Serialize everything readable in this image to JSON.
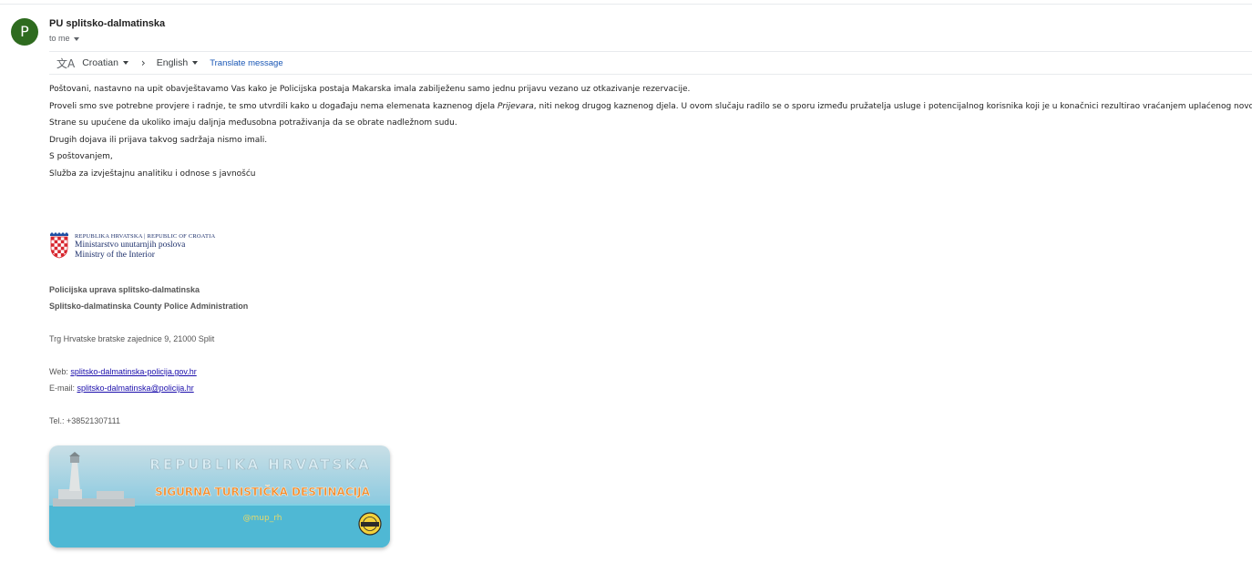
{
  "sender": {
    "avatar_letter": "P",
    "name": "PU splitsko-dalmatinska",
    "to_label": "to me"
  },
  "translate_bar": {
    "source_lang": "Croatian",
    "target_lang": "English",
    "translate_label": "Translate message"
  },
  "message": {
    "lines": [
      "Poštovani, nastavno na upit obavještavamo Vas kako je Policijska postaja Makarska imala zabilježenu samo jednu prijavu vezano uz otkazivanje rezervacije.",
      "Strane su upućene da ukoliko imaju daljnja međusobna potraživanja da se obrate nadležnom sudu.",
      "Drugih dojava ili prijava takvog sadržaja nismo imali.",
      "S poštovanjem,",
      "Služba za izvještajnu analitiku i odnose s javnošću"
    ],
    "line2": {
      "before": "Proveli smo sve potrebne provjere i radnje, te smo utvrdili kako u događaju nema elemenata kaznenog djela ",
      "italic": "Prijevara",
      "after": ", niti nekog drugog kaznenog djela. U ovom slučaju radilo se o sporu između pružatelja usluge i potencijalnog korisnika koji je u konačnici rezultirao vraćanjem uplaćenog novca."
    }
  },
  "logo": {
    "top_line": "REPUBLIKA HRVATSKA  |  REPUBLIC OF CROATIA",
    "ministry_hr": "Ministarstvo unutarnjih poslova",
    "ministry_en": "Ministry of the Interior"
  },
  "signature": {
    "org_hr": "Policijska uprava splitsko-dalmatinska",
    "org_en": "Splitsko-dalmatinska County Police Administration",
    "address": "Trg Hrvatske bratske zajednice 9, 21000 Split",
    "web_label": "Web: ",
    "web_url": "splitsko-dalmatinska-policija.gov.hr",
    "email_label": "E-mail: ",
    "email": "splitsko-dalmatinska@policija.hr",
    "tel": "Tel.: +38521307111"
  },
  "banner": {
    "title": "REPUBLIKA HRVATSKA",
    "subtitle": "SIGURNA TURISTIČKA DESTINACIJA",
    "handle": "@mup_rh",
    "sea_color": "#4fb8d4",
    "accent_color": "#f08a2b"
  }
}
